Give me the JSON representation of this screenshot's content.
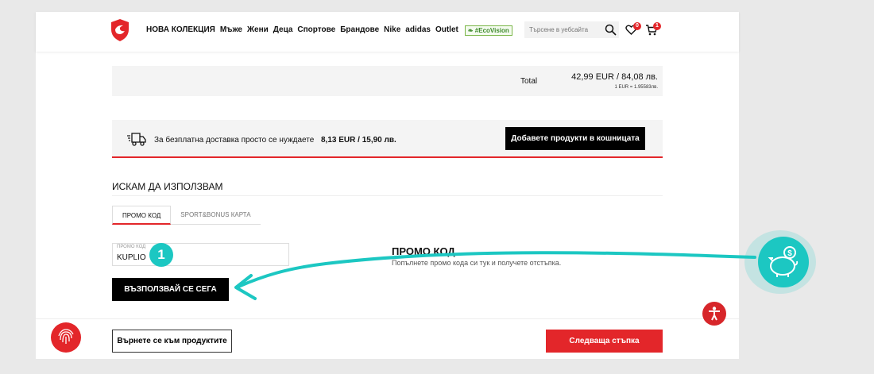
{
  "header": {
    "nav": [
      "НОВА КОЛЕКЦИЯ",
      "Мъже",
      "Жени",
      "Деца",
      "Спортове",
      "Брандове",
      "Nike",
      "adidas",
      "Outlet"
    ],
    "eco_label": "#EcoVision",
    "search_placeholder": "Търсене в уебсайта",
    "wishlist_count": "0",
    "cart_count": "1"
  },
  "summary": {
    "total_label": "Total",
    "total_value": "42,99 EUR / 84,08 лв.",
    "rate": "1 EUR = 1.95583лв."
  },
  "shipping": {
    "text": "За безплатна доставка просто се нуждаете",
    "amount": "8,13 EUR / 15,90 лв.",
    "button": "Добавете продукти в кошницата"
  },
  "discount": {
    "title": "ИСКАМ ДА ИЗПОЛЗВАМ",
    "tabs": [
      "ПРОМО КОД",
      "SPORT&BONUS КАРТА"
    ],
    "field_label": "ПРОМО КОД",
    "field_value": "KUPLIO",
    "step": "1",
    "apply_button": "ВЪЗПОЛЗВАЙ СЕ СЕГА",
    "heading": "ПРОМО КОД",
    "description": "Попълнете промо кода си тук и получете отстъпка."
  },
  "footer": {
    "back_button": "Върнете се към продуктите",
    "next_button": "Следваща стъпка"
  },
  "colors": {
    "accent": "#e3262a",
    "annotation": "#1cc7c2"
  }
}
